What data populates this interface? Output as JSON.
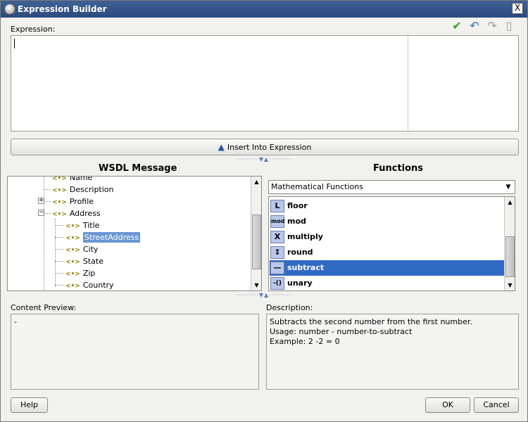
{
  "window": {
    "title": "Expression Builder",
    "close": "X"
  },
  "expression": {
    "label": "Expression:",
    "value": ""
  },
  "toolbar": {
    "check": "✔",
    "undo": "↶",
    "redo": "↷",
    "copy": "▯"
  },
  "insert": {
    "label": "Insert Into Expression"
  },
  "wsdl": {
    "title": "WSDL Message",
    "items": [
      "Name",
      "Description",
      "Profile",
      "Address",
      "Title",
      "StreetAddress",
      "City",
      "State",
      "Zip",
      "Country"
    ]
  },
  "functions": {
    "title": "Functions",
    "category": "Mathematical Functions",
    "items": [
      {
        "icon": "L",
        "name": "floor"
      },
      {
        "icon": "mod",
        "name": "mod"
      },
      {
        "icon": "X",
        "name": "multiply"
      },
      {
        "icon": "↕",
        "name": "round"
      },
      {
        "icon": "—",
        "name": "subtract"
      },
      {
        "icon": "-()",
        "name": "unary"
      }
    ]
  },
  "content_preview": {
    "label": "Content Preview:",
    "value": "-"
  },
  "description": {
    "label": "Description:",
    "line1": "Subtracts the second number from the first number.",
    "line2": "Usage: number - number-to-subtract",
    "line3": "Example: 2 -2 = 0"
  },
  "buttons": {
    "help": "Help",
    "ok": "OK",
    "cancel": "Cancel"
  }
}
